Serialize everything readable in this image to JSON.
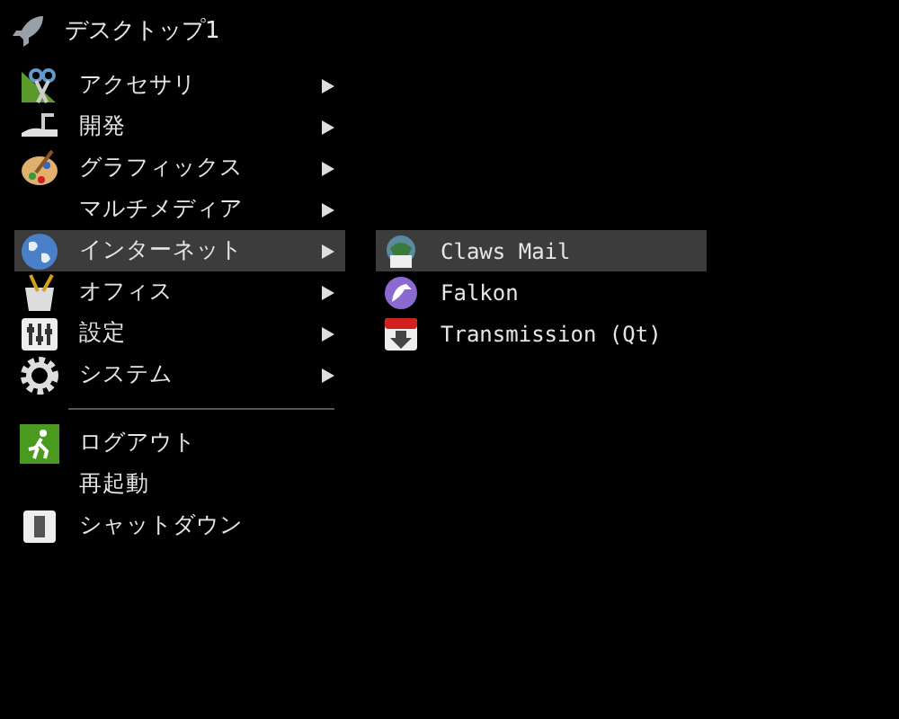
{
  "title": "デスクトップ1",
  "items": [
    {
      "label": "アクセサリ",
      "has_submenu": true,
      "selected": false
    },
    {
      "label": "開発",
      "has_submenu": true,
      "selected": false
    },
    {
      "label": "グラフィックス",
      "has_submenu": true,
      "selected": false
    },
    {
      "label": "マルチメディア",
      "has_submenu": true,
      "selected": false
    },
    {
      "label": "インターネット",
      "has_submenu": true,
      "selected": true
    },
    {
      "label": "オフィス",
      "has_submenu": true,
      "selected": false
    },
    {
      "label": "設定",
      "has_submenu": true,
      "selected": false
    },
    {
      "label": "システム",
      "has_submenu": true,
      "selected": false
    }
  ],
  "session_items": [
    {
      "label": "ログアウト",
      "selected": false
    },
    {
      "label": "再起動",
      "selected": false
    },
    {
      "label": "シャットダウン",
      "selected": false
    }
  ],
  "submenu": [
    {
      "label": "Claws Mail",
      "selected": true
    },
    {
      "label": "Falkon",
      "selected": false
    },
    {
      "label": "Transmission (Qt)",
      "selected": false
    }
  ]
}
